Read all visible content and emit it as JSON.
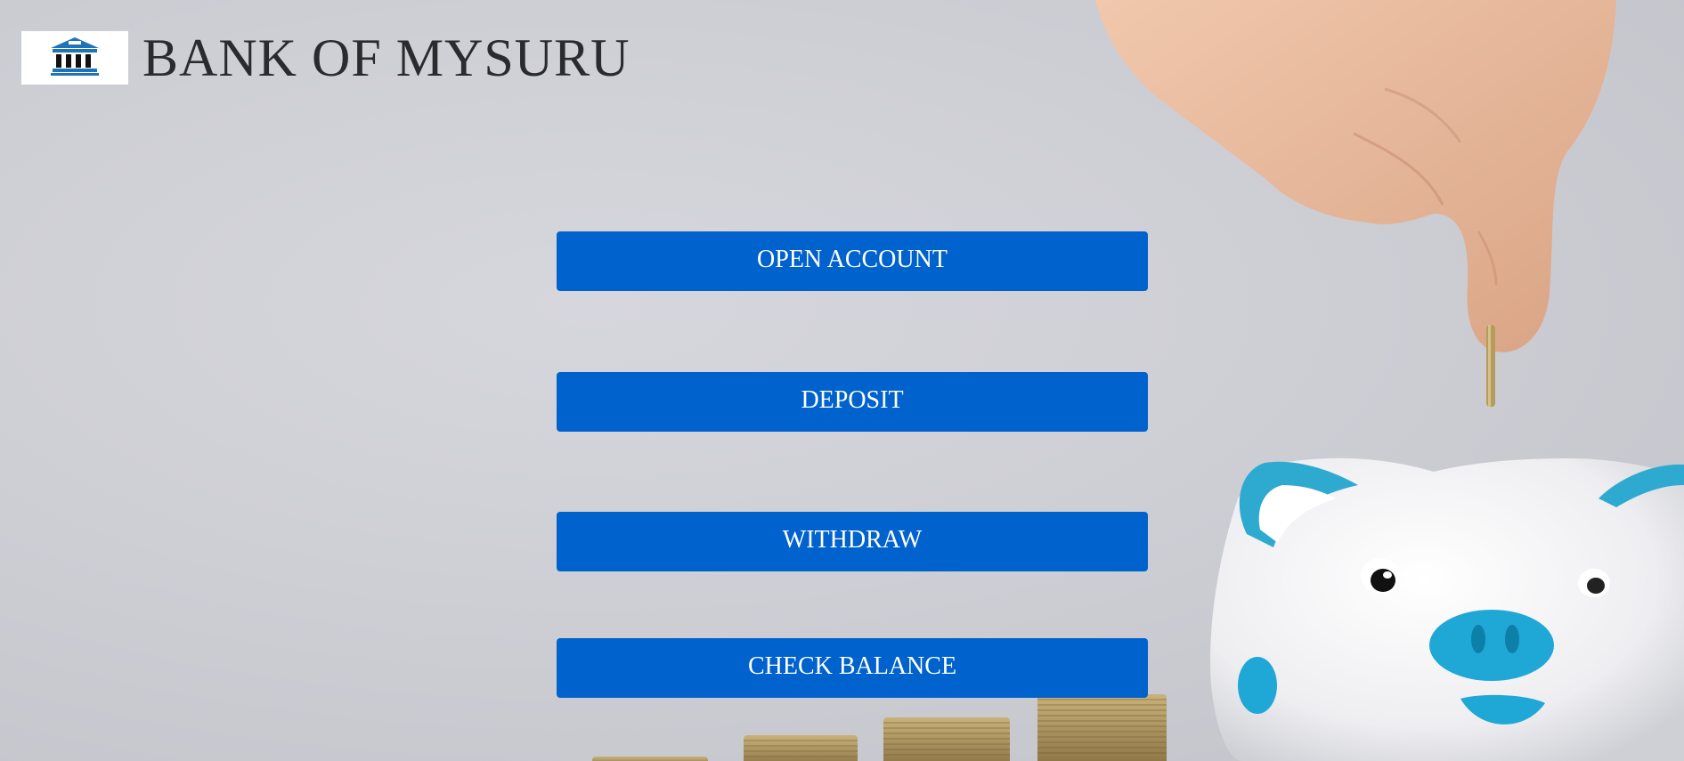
{
  "header": {
    "logo_icon": "bank-building-icon",
    "title": "BANK OF MYSURU"
  },
  "menu": {
    "open_account_label": "OPEN ACCOUNT",
    "deposit_label": "DEPOSIT",
    "withdraw_label": "WITHDRAW",
    "check_balance_label": "CHECK BALANCE"
  },
  "colors": {
    "button_background": "#0062cc",
    "button_text": "#ffffff",
    "title_text": "#2a2b2f",
    "logo_blue": "#1f73b7"
  }
}
